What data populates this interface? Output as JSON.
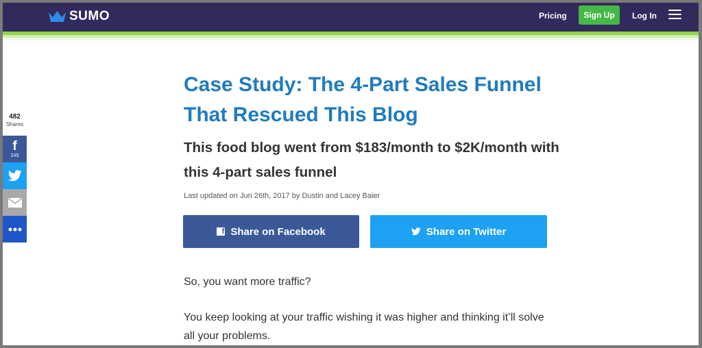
{
  "header": {
    "logo_text": "SUMO",
    "nav": {
      "pricing": "Pricing",
      "signup": "Sign Up",
      "login": "Log In"
    },
    "colors": {
      "bar": "#322a5d",
      "accent": "#45b848",
      "logo_crown": "#2f8be6"
    }
  },
  "share_sidebar": {
    "total_count": "482",
    "total_label": "Shares",
    "facebook_count": "245",
    "icons": [
      "facebook-icon",
      "twitter-icon",
      "email-icon",
      "more-icon"
    ]
  },
  "article": {
    "title": "Case Study: The 4-Part Sales Funnel That Rescued This Blog",
    "subtitle": "This food blog went from $183/month to $2K/month with this 4-part sales funnel",
    "byline": "Last updated on Jun 26th, 2017 by Dustin and Lacey Baier",
    "share_facebook": "Share on Facebook",
    "share_twitter": "Share on Twitter",
    "paragraphs": [
      "So, you want more traffic?",
      "You keep looking at your traffic wishing it was higher and thinking it’ll solve all your problems."
    ],
    "colors": {
      "title": "#1f7bbf",
      "facebook": "#3b5998",
      "twitter": "#1da1f2"
    }
  }
}
